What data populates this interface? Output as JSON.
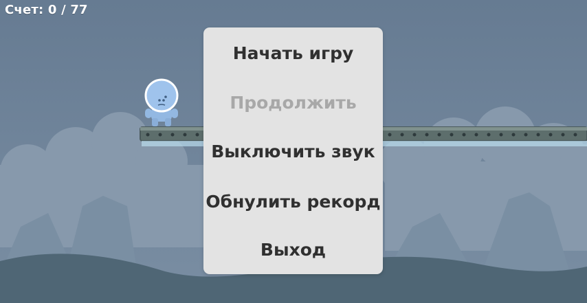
{
  "hud": {
    "score_label": "Счет:",
    "score_current": "0",
    "score_separator": "/",
    "score_total": "77"
  },
  "menu": {
    "items": [
      {
        "label": "Начать игру",
        "enabled": true
      },
      {
        "label": "Продолжить",
        "enabled": false
      },
      {
        "label": "Выключить звук",
        "enabled": true
      },
      {
        "label": "Обнулить рекорд",
        "enabled": true
      },
      {
        "label": "Выход",
        "enabled": true
      }
    ]
  },
  "colors": {
    "sky": "#6f8399",
    "mountains": "#7d90a3",
    "clouds": "#8fa2b3",
    "ground": "#4e6473",
    "menu_bg": "#e3e3e3",
    "menu_text": "#303030",
    "menu_text_disabled": "#a8a8a8",
    "player": "#9cc1ea"
  }
}
